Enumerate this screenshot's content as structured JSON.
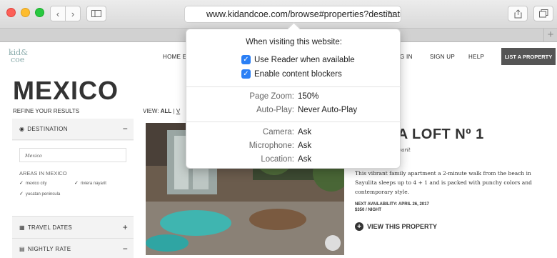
{
  "browser": {
    "url": "www.kidandcoe.com/browse#properties?destination_",
    "back_icon": "chevron-left-icon",
    "forward_icon": "chevron-right-icon",
    "sidebar_icon": "sidebar-icon",
    "share_icon": "share-icon",
    "tabs_icon": "tabs-icon",
    "new_tab": "+"
  },
  "site": {
    "logo_top": "kid&",
    "logo_bottom": "coe",
    "nav": [
      "HOME EXC",
      "G IN",
      "SIGN UP",
      "HELP"
    ],
    "list_property": "LIST A PROPERTY",
    "page_title": "MEXICO",
    "refine": "REFINE YOUR RESULTS",
    "view_label": "VIEW:",
    "view_all": "ALL",
    "view_sep": "|",
    "view_next": "V"
  },
  "sidebar": {
    "destination": {
      "label": "DESTINATION",
      "toggle": "−"
    },
    "dest_input": "Mexico",
    "areas_label": "AREAS IN MEXICO",
    "areas": [
      "mexico city",
      "riviera nayarit",
      "yucatan peninsula"
    ],
    "travel_dates": {
      "label": "TRAVEL DATES",
      "toggle": "+"
    },
    "nightly_rate": {
      "label": "NIGHTLY RATE",
      "toggle": "−"
    }
  },
  "listing": {
    "title": "YULITA LOFT Nº 1",
    "location": "Nayarit",
    "description": "This vibrant family apartment a 2-minute walk from the beach in Sayulita sleeps up to 4 + 1 and is packed with punchy colors and contemporary style.",
    "availability": "NEXT AVAILABILITY: APRIL 26, 2017",
    "price": "$350 / NIGHT",
    "cta": "VIEW THIS PROPERTY"
  },
  "popover": {
    "heading": "When visiting this website:",
    "options": [
      {
        "label": "Use Reader when available",
        "checked": true
      },
      {
        "label": "Enable content blockers",
        "checked": true
      }
    ],
    "settings1": [
      {
        "label": "Page Zoom:",
        "value": "150%"
      },
      {
        "label": "Auto-Play:",
        "value": "Never Auto-Play"
      }
    ],
    "settings2": [
      {
        "label": "Camera:",
        "value": "Ask"
      },
      {
        "label": "Microphone:",
        "value": "Ask"
      },
      {
        "label": "Location:",
        "value": "Ask"
      }
    ]
  }
}
